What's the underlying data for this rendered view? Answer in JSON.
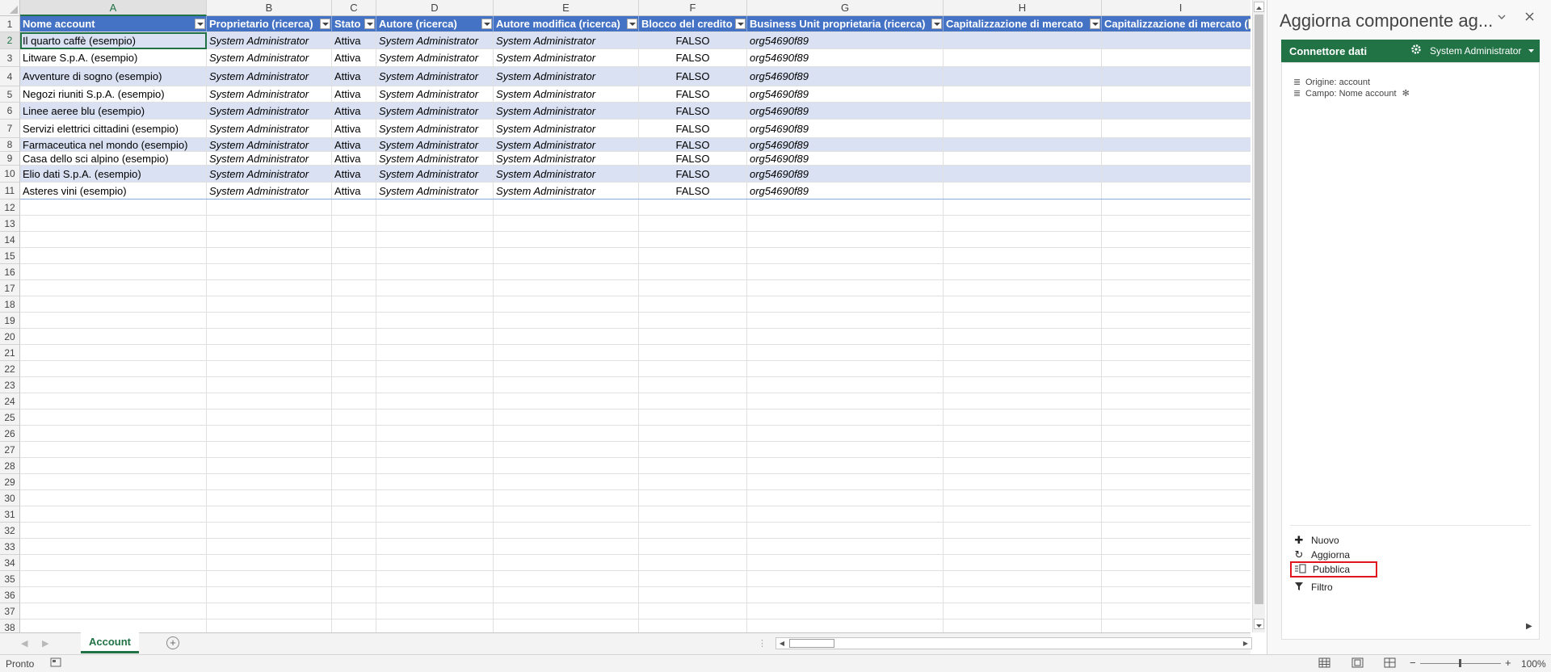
{
  "columns": [
    "A",
    "B",
    "C",
    "D",
    "E",
    "F",
    "G",
    "H",
    "I"
  ],
  "table": {
    "headers": [
      "Nome account",
      "Proprietario (ricerca)",
      "Stato",
      "Autore (ricerca)",
      "Autore modifica (ricerca)",
      "Blocco del credito",
      "Business Unit proprietaria (ricerca)",
      "Capitalizzazione di mercato",
      "Capitalizzazione di mercato (b"
    ],
    "rows": [
      [
        "Il quarto caffè (esempio)",
        "System Administrator",
        "Attiva",
        "System Administrator",
        "System Administrator",
        "FALSO",
        "org54690f89",
        "",
        ""
      ],
      [
        "Litware S.p.A. (esempio)",
        "System Administrator",
        "Attiva",
        "System Administrator",
        "System Administrator",
        "FALSO",
        "org54690f89",
        "",
        ""
      ],
      [
        "Avventure di sogno (esempio)",
        "System Administrator",
        "Attiva",
        "System Administrator",
        "System Administrator",
        "FALSO",
        "org54690f89",
        "",
        ""
      ],
      [
        "Negozi riuniti S.p.A. (esempio)",
        "System Administrator",
        "Attiva",
        "System Administrator",
        "System Administrator",
        "FALSO",
        "org54690f89",
        "",
        ""
      ],
      [
        "Linee aeree blu (esempio)",
        "System Administrator",
        "Attiva",
        "System Administrator",
        "System Administrator",
        "FALSO",
        "org54690f89",
        "",
        ""
      ],
      [
        "Servizi elettrici cittadini (esempio)",
        "System Administrator",
        "Attiva",
        "System Administrator",
        "System Administrator",
        "FALSO",
        "org54690f89",
        "",
        ""
      ],
      [
        "Farmaceutica nel mondo (esempio)",
        "System Administrator",
        "Attiva",
        "System Administrator",
        "System Administrator",
        "FALSO",
        "org54690f89",
        "",
        ""
      ],
      [
        "Casa dello sci alpino (esempio)",
        "System Administrator",
        "Attiva",
        "System Administrator",
        "System Administrator",
        "FALSO",
        "org54690f89",
        "",
        ""
      ],
      [
        "Elio dati S.p.A. (esempio)",
        "System Administrator",
        "Attiva",
        "System Administrator",
        "System Administrator",
        "FALSO",
        "org54690f89",
        "",
        ""
      ],
      [
        "Asteres vini (esempio)",
        "System Administrator",
        "Attiva",
        "System Administrator",
        "System Administrator",
        "FALSO",
        "org54690f89",
        "",
        ""
      ]
    ]
  },
  "row_numbers": [
    "1",
    "2",
    "3",
    "4",
    "5",
    "6",
    "7",
    "8",
    "9",
    "10",
    "11",
    "12",
    "13",
    "14",
    "15",
    "16",
    "17",
    "18",
    "19",
    "20",
    "21",
    "22",
    "23",
    "24",
    "25",
    "26",
    "27",
    "28",
    "29",
    "30",
    "31",
    "32",
    "33",
    "34",
    "35",
    "36",
    "37",
    "38"
  ],
  "sheet_tab": "Account",
  "status": {
    "ready": "Pronto",
    "zoom": "100%"
  },
  "pane": {
    "title": "Aggiorna componente ag...",
    "connector": "Connettore dati",
    "user": "System Administrator",
    "origin": "Origine: account",
    "field": "Campo: Nome account",
    "actions": [
      "Nuovo",
      "Aggiorna",
      "Pubblica",
      "Filtro"
    ]
  },
  "colors": {
    "excel_green": "#217346",
    "table_header": "#4472c4",
    "band": "#d9e1f2",
    "highlight": "#e0151f"
  }
}
